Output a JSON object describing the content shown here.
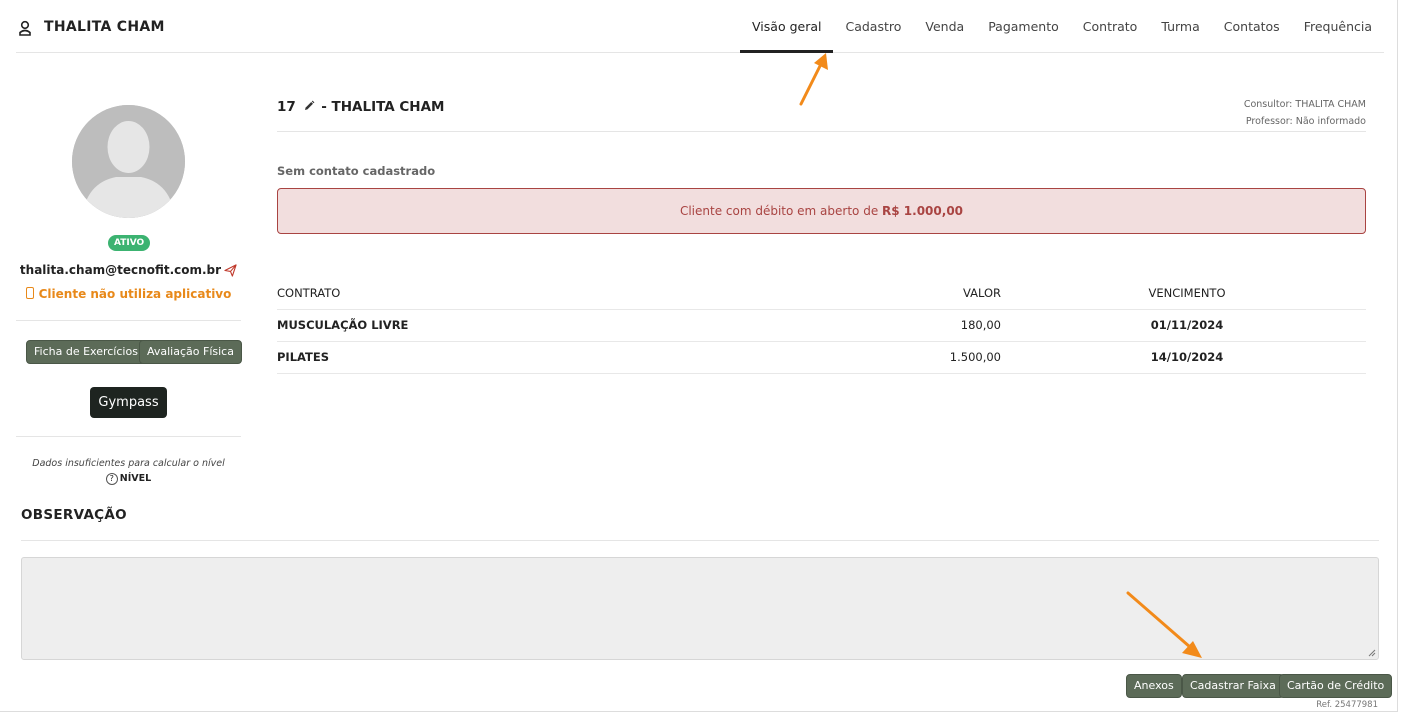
{
  "header": {
    "client_name": "THALITA CHAM",
    "tabs": [
      "Visão geral",
      "Cadastro",
      "Venda",
      "Pagamento",
      "Contrato",
      "Turma",
      "Contatos",
      "Frequência"
    ],
    "active_tab": "Visão geral"
  },
  "profile": {
    "status": "ATIVO",
    "email": "thalita.cham@tecnofit.com.br",
    "app_status": "Cliente não utiliza aplicativo",
    "buttons": {
      "exercise_sheet": "Ficha de Exercícios",
      "physical_eval": "Avaliação Física",
      "gympass": "Gympass"
    },
    "level_note": "Dados insuficientes para calcular o nível",
    "level_label": "NÍVEL"
  },
  "main": {
    "client_id": "17",
    "title_suffix": "- THALITA CHAM",
    "consultant": "Consultor: THALITA CHAM",
    "teacher": "Professor: Não informado",
    "no_contact": "Sem contato cadastrado",
    "debt_text": "Cliente com débito em aberto de",
    "debt_amount": "R$ 1.000,00",
    "table": {
      "headers": [
        "CONTRATO",
        "VALOR",
        "VENCIMENTO"
      ],
      "rows": [
        [
          "MUSCULAÇÃO LIVRE",
          "180,00",
          "01/11/2024"
        ],
        [
          "PILATES",
          "1.500,00",
          "14/10/2024"
        ]
      ]
    }
  },
  "observation": {
    "title": "OBSERVAÇÃO"
  },
  "footer": {
    "attachments": "Anexos",
    "register_band": "Cadastrar Faixa",
    "credit_card": "Cartão de Crédito",
    "ref": "Ref. 25477981"
  },
  "colors": {
    "accent_green": "#5c6b58",
    "status_green": "#3cb371",
    "alert_red": "#a94442",
    "alert_bg": "#f2dede",
    "orange": "#e8891a",
    "annotation_arrow": "#f28a1a"
  }
}
